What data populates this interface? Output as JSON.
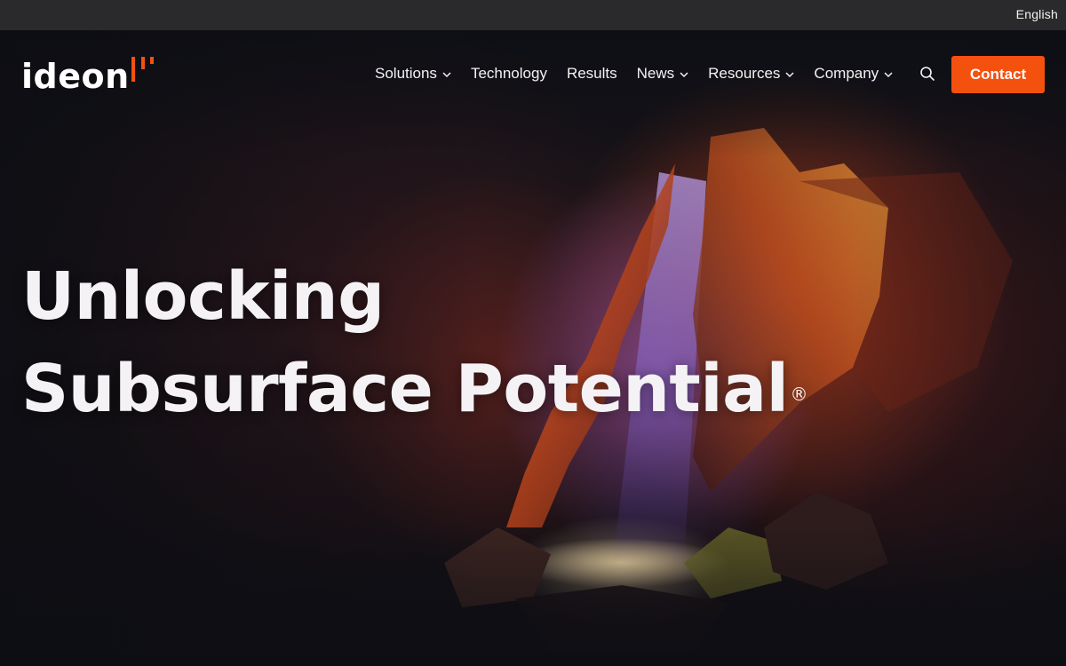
{
  "utility_bar": {
    "language": "English"
  },
  "header": {
    "logo_text": "ideon",
    "nav": [
      {
        "label": "Solutions",
        "has_dropdown": true
      },
      {
        "label": "Technology",
        "has_dropdown": false
      },
      {
        "label": "Results",
        "has_dropdown": false
      },
      {
        "label": "News",
        "has_dropdown": true
      },
      {
        "label": "Resources",
        "has_dropdown": true
      },
      {
        "label": "Company",
        "has_dropdown": true
      }
    ],
    "search_icon": "search-icon",
    "contact_label": "Contact"
  },
  "hero": {
    "headline_line1": "Unlocking",
    "headline_line2": "Subsurface Potential",
    "registered_mark": "®"
  },
  "colors": {
    "accent": "#f4510f",
    "utility_bar_bg": "#2a2a2c",
    "page_bg": "#0d0e13",
    "text": "#ffffff"
  }
}
